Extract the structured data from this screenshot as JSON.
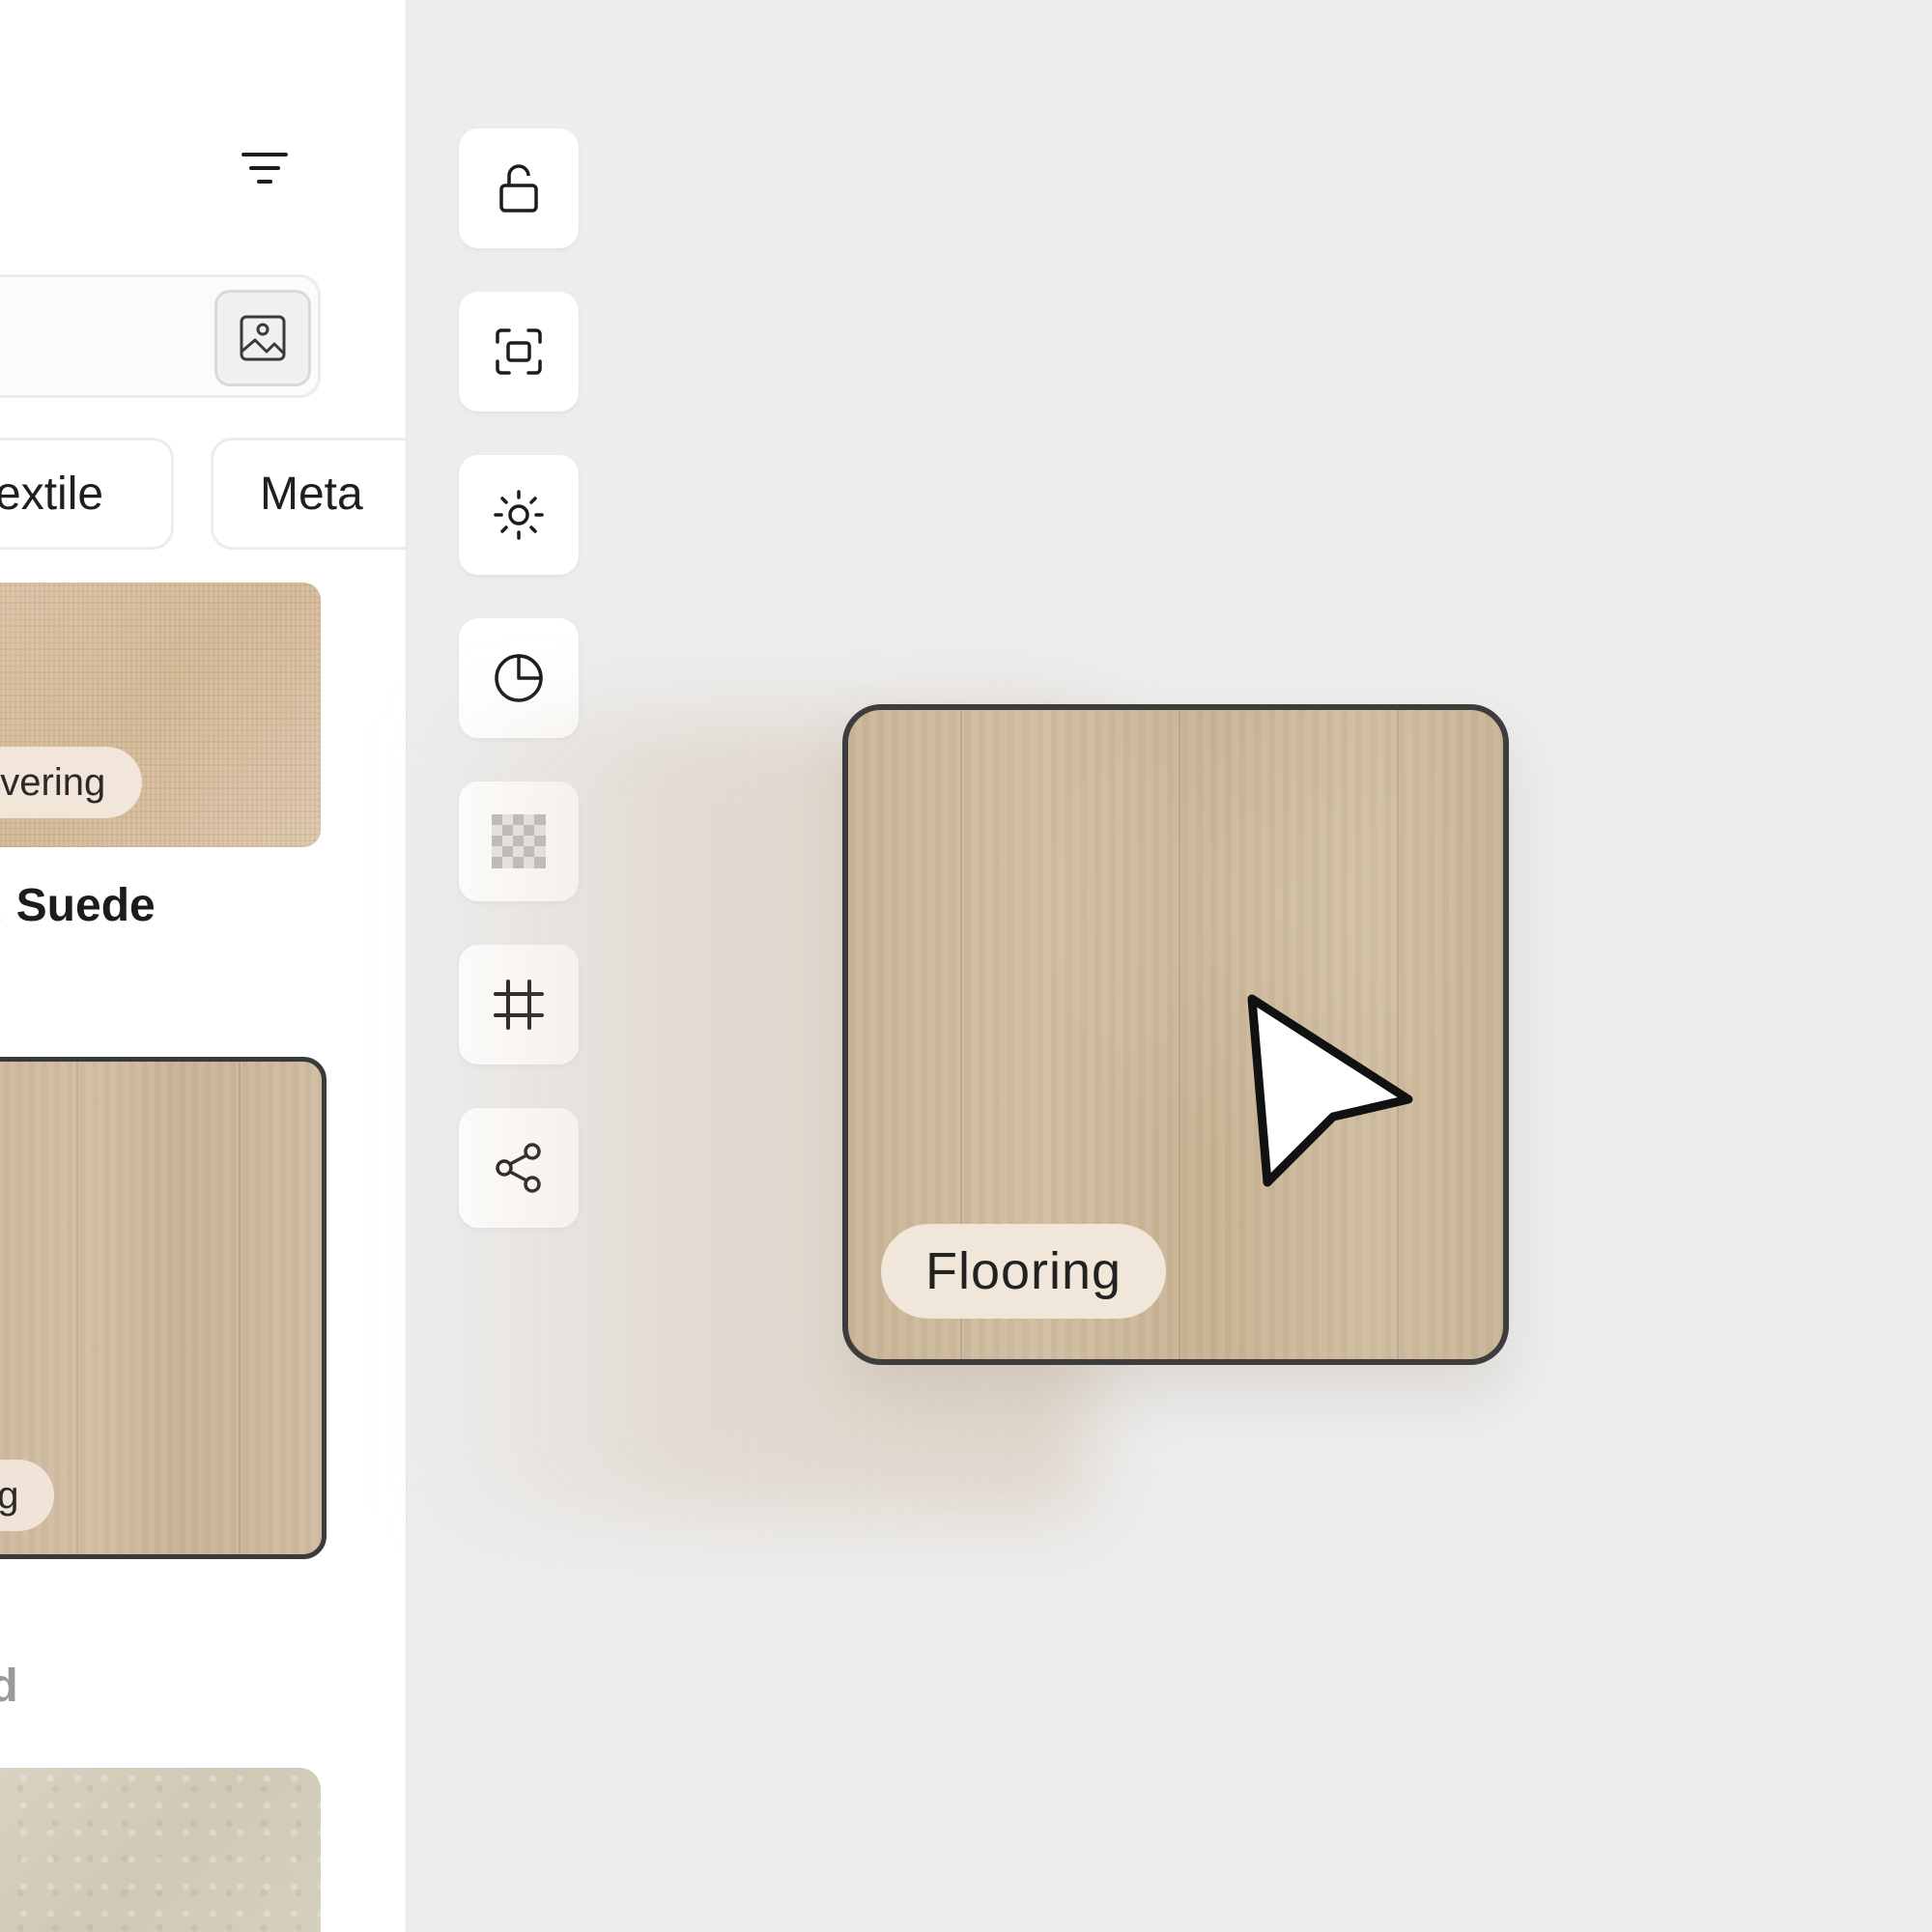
{
  "toolbar": {
    "tools": [
      {
        "icon": "unlock-icon"
      },
      {
        "icon": "focus-frame-icon"
      },
      {
        "icon": "brightness-icon"
      },
      {
        "icon": "contrast-icon"
      },
      {
        "icon": "transparency-icon"
      },
      {
        "icon": "crop-grid-icon"
      },
      {
        "icon": "share-icon"
      }
    ]
  },
  "panel": {
    "filter_icon": "filter-icon",
    "image_search_icon": "image-icon",
    "chips": [
      "extile",
      "Meta"
    ],
    "cards": [
      {
        "tag": "overing",
        "title": "d Suede"
      },
      {
        "tag": "ng",
        "title": "od"
      }
    ]
  },
  "canvas": {
    "dragged_card": {
      "tag": "Flooring"
    },
    "cursor_icon": "pointer-arrow-icon"
  },
  "colors": {
    "background": "#ededed",
    "panel": "#ffffff",
    "tag_bg": "#f1e8dc",
    "border_dark": "#3d3d3d"
  }
}
